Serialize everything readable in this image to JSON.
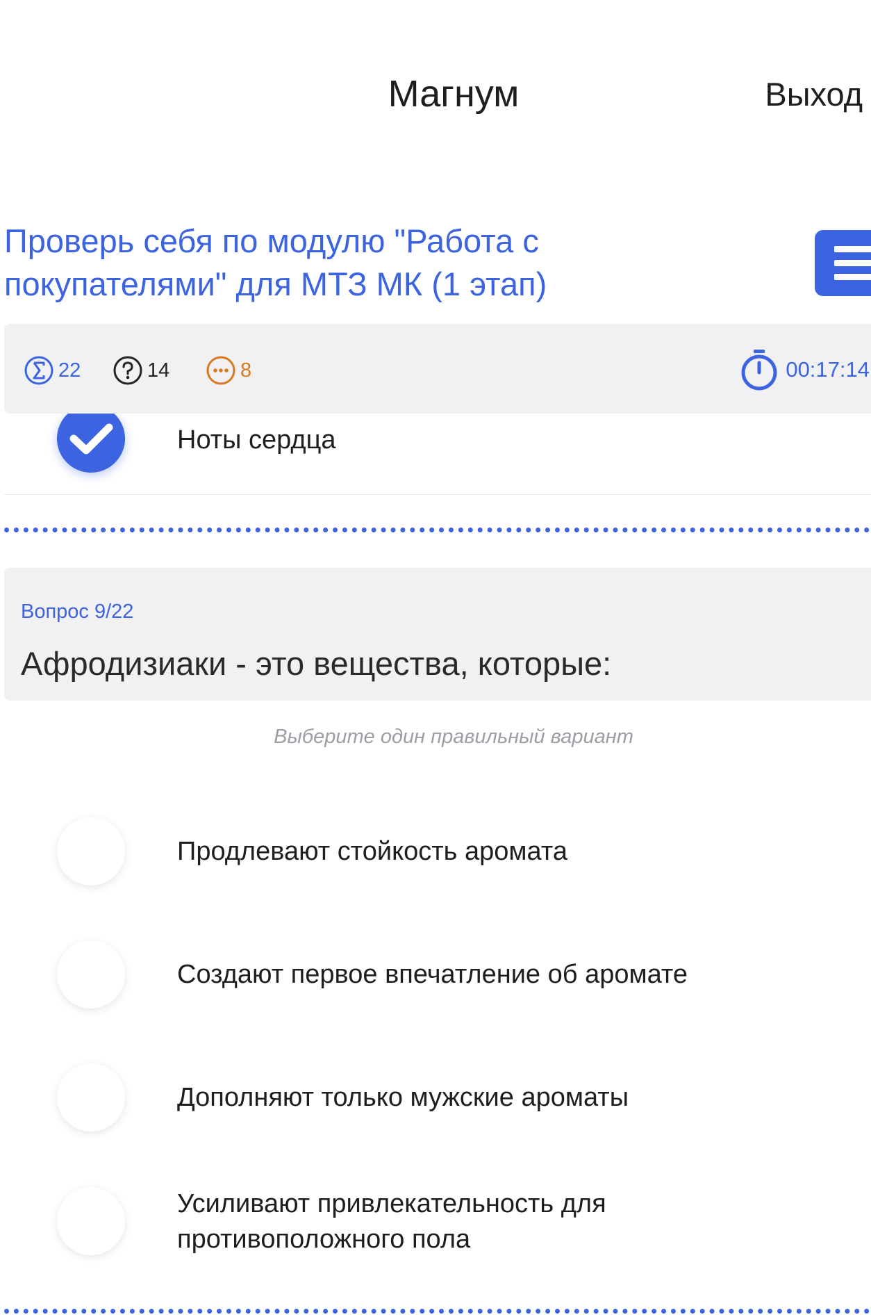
{
  "header": {
    "title": "Магнум",
    "logout_label": "Выход"
  },
  "course": {
    "title": "Проверь себя по модулю \"Работа с покупателями\" для МТЗ МК (1 этап)"
  },
  "stats": {
    "total": "22",
    "unanswered": "14",
    "skipped": "8",
    "timer": "00:17:14"
  },
  "previous_question": {
    "selected_answer": "Ноты сердца"
  },
  "question": {
    "number_label": "Вопрос 9/22",
    "text": "Афродизиаки - это вещества, которые:",
    "hint": "Выберите один правильный вариант",
    "options": [
      "Продлевают стойкость аромата",
      "Создают первое впечатление об аромате",
      "Дополняют только мужские ароматы",
      "Усиливают привлекательность для противоположного пола"
    ]
  },
  "colors": {
    "accent": "#3c63e0",
    "skipped": "#d9791f",
    "card_bg": "#f1f1f3"
  }
}
